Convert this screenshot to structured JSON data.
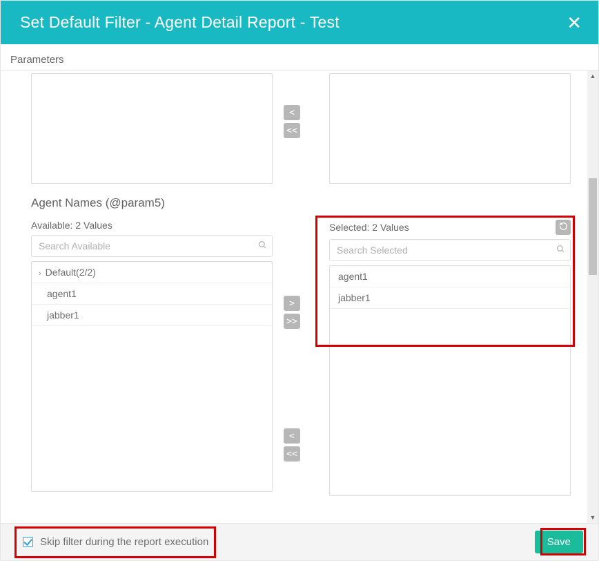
{
  "header": {
    "title": "Set Default Filter - Agent Detail Report - Test",
    "close_icon": "close-icon"
  },
  "parameters_label": "Parameters",
  "upper_section": {
    "transfer_left_label": "<",
    "transfer_all_left_label": "<<"
  },
  "agent_names": {
    "title": "Agent Names (@param5)",
    "available": {
      "header": "Available: 2 Values",
      "search_placeholder": "Search Available",
      "group_label": "Default(2/2)",
      "items": [
        "agent1",
        "jabber1"
      ]
    },
    "selected": {
      "header": "Selected: 2 Values",
      "search_placeholder": "Search Selected",
      "items": [
        "agent1",
        "jabber1"
      ],
      "refresh_icon": "refresh-icon"
    },
    "transfer": {
      "right": ">",
      "all_right": ">>",
      "left": "<",
      "all_left": "<<"
    }
  },
  "footer": {
    "skip_label": "Skip filter during the report execution",
    "skip_checked": true,
    "save_label": "Save"
  }
}
